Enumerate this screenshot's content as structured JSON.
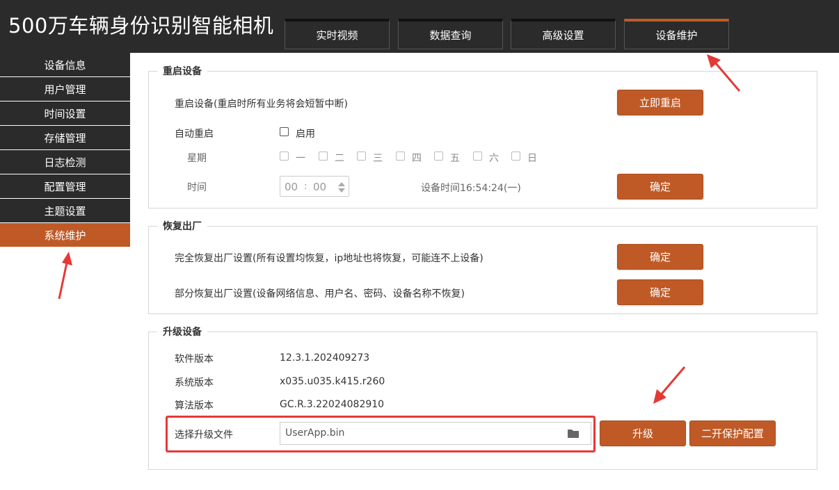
{
  "header": {
    "title": "500万车辆身份识别智能相机",
    "tabs": [
      {
        "label": "实时视频"
      },
      {
        "label": "数据查询"
      },
      {
        "label": "高级设置"
      },
      {
        "label": "设备维护"
      }
    ]
  },
  "sidebar": {
    "items": [
      {
        "label": "设备信息"
      },
      {
        "label": "用户管理"
      },
      {
        "label": "时间设置"
      },
      {
        "label": "存储管理"
      },
      {
        "label": "日志检测"
      },
      {
        "label": "配置管理"
      },
      {
        "label": "主题设置"
      },
      {
        "label": "系统维护"
      }
    ]
  },
  "reboot": {
    "title": "重启设备",
    "desc": "重启设备(重启时所有业务将会短暂中断)",
    "reboot_now": "立即重启",
    "auto_label": "自动重启",
    "enable_label": "启用",
    "week_label": "星期",
    "days": [
      "一",
      "二",
      "三",
      "四",
      "五",
      "六",
      "日"
    ],
    "time_label": "时间",
    "hour": "00",
    "minute": "00",
    "time_sep": ":",
    "device_time": "设备时间16:54:24(一)",
    "confirm": "确定"
  },
  "factory": {
    "title": "恢复出厂",
    "full_desc": "完全恢复出厂设置(所有设置均恢复，ip地址也将恢复，可能连不上设备)",
    "full_confirm": "确定",
    "partial_desc": "部分恢复出厂设置(设备网络信息、用户名、密码、设备名称不恢复)",
    "partial_confirm": "确定"
  },
  "upgrade": {
    "title": "升级设备",
    "software_label": "软件版本",
    "software_value": "12.3.1.202409273",
    "system_label": "系统版本",
    "system_value": "x035.u035.k415.r260",
    "algorithm_label": "算法版本",
    "algorithm_value": "GC.R.3.22024082910",
    "file_label": "选择升级文件",
    "file_value": "UserApp.bin",
    "upgrade_button": "升级",
    "protect_button": "二开保护配置"
  },
  "colors": {
    "accent": "#bf5a26",
    "dark": "#2b2b2b",
    "annotation": "#e53935"
  }
}
